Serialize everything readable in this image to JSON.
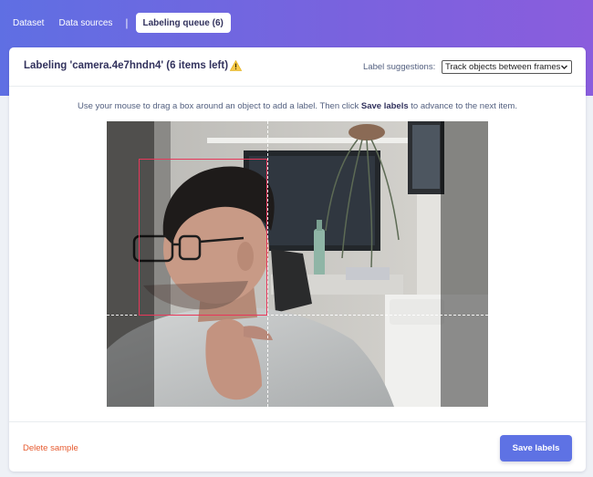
{
  "nav": {
    "tabs": [
      {
        "label": "Dataset"
      },
      {
        "label": "Data sources"
      }
    ],
    "separator": "|",
    "active_tab": {
      "label": "Labeling queue (6)"
    }
  },
  "labeling": {
    "title": "Labeling 'camera.4e7hndn4' (6 items left)",
    "warning_icon": "warning-triangle-icon",
    "suggestions_label": "Label suggestions:",
    "suggestions_value": "Track objects between frames",
    "instruction_prefix": "Use your mouse to drag a box around an object to add a label. Then click ",
    "instruction_bold": "Save labels",
    "instruction_suffix": " to advance to the next item.",
    "delete_label": "Delete sample",
    "save_label": "Save labels"
  },
  "colors": {
    "accent": "#5e72e4",
    "bbox": "#e8375a",
    "delete": "#e65a2f",
    "warning": "#f7c948"
  }
}
